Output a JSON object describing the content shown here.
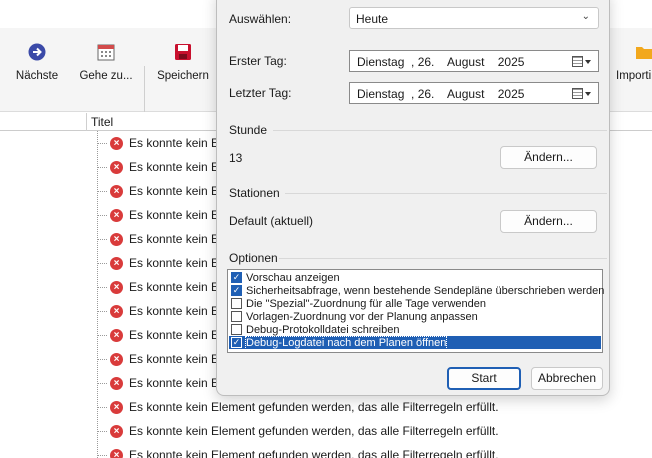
{
  "toolbar": {
    "next_label": "Nächste",
    "goto_label": "Gehe zu...",
    "save_label": "Speichern",
    "import_label": "Importi"
  },
  "list": {
    "column_title": "Titel",
    "rows_truncated": [
      "Es konnte kein Elem",
      "Es konnte kein Elem",
      "Es konnte kein Elem",
      "Es konnte kein Elem",
      "Es konnte kein Elem",
      "Es konnte kein Elem",
      "Es konnte kein Elem",
      "Es konnte kein Elem",
      "Es konnte kein Elem",
      "Es konnte kein Elem",
      "Es konnte kein Elem"
    ],
    "row_full": "Es konnte kein Element gefunden werden, das alle Filterregeln erfüllt."
  },
  "dialog": {
    "select_label": "Auswählen:",
    "select_value": "Heute",
    "first_day_label": "Erster Tag:",
    "first_day_value": "Dienstag  , 26.    August    2025",
    "last_day_label": "Letzter Tag:",
    "last_day_value": "Dienstag  , 26.    August    2025",
    "hour_group": "Stunde",
    "hour_value": "13",
    "change_label": "Ändern...",
    "stations_group": "Stationen",
    "stations_value": "Default (aktuell)",
    "options_group": "Optionen",
    "options": [
      {
        "label": "Vorschau anzeigen",
        "checked": true
      },
      {
        "label": "Sicherheitsabfrage, wenn bestehende Sendepläne überschrieben werden",
        "checked": true
      },
      {
        "label": "Die \"Spezial\"-Zuordnung für alle Tage verwenden",
        "checked": false
      },
      {
        "label": "Vorlagen-Zuordnung vor der Planung anpassen",
        "checked": false
      },
      {
        "label": "Debug-Protokolldatei schreiben",
        "checked": false
      },
      {
        "label": "Debug-Logdatei nach dem Planen öffnen",
        "checked": true,
        "selected": true
      }
    ],
    "start_label": "Start",
    "cancel_label": "Abbrechen"
  },
  "colors": {
    "accent": "#1f5fb4",
    "error": "#d93b3b",
    "save_icon": "#c8102e",
    "next_icon": "#3b4aa8",
    "folder_icon": "#f2a81d"
  },
  "icons": {
    "next": "arrow-right-circle-icon",
    "goto": "calendar-icon",
    "save": "floppy-disk-icon",
    "import": "folder-icon",
    "row": "error-icon",
    "date_picker": "calendar-dropdown-icon"
  }
}
